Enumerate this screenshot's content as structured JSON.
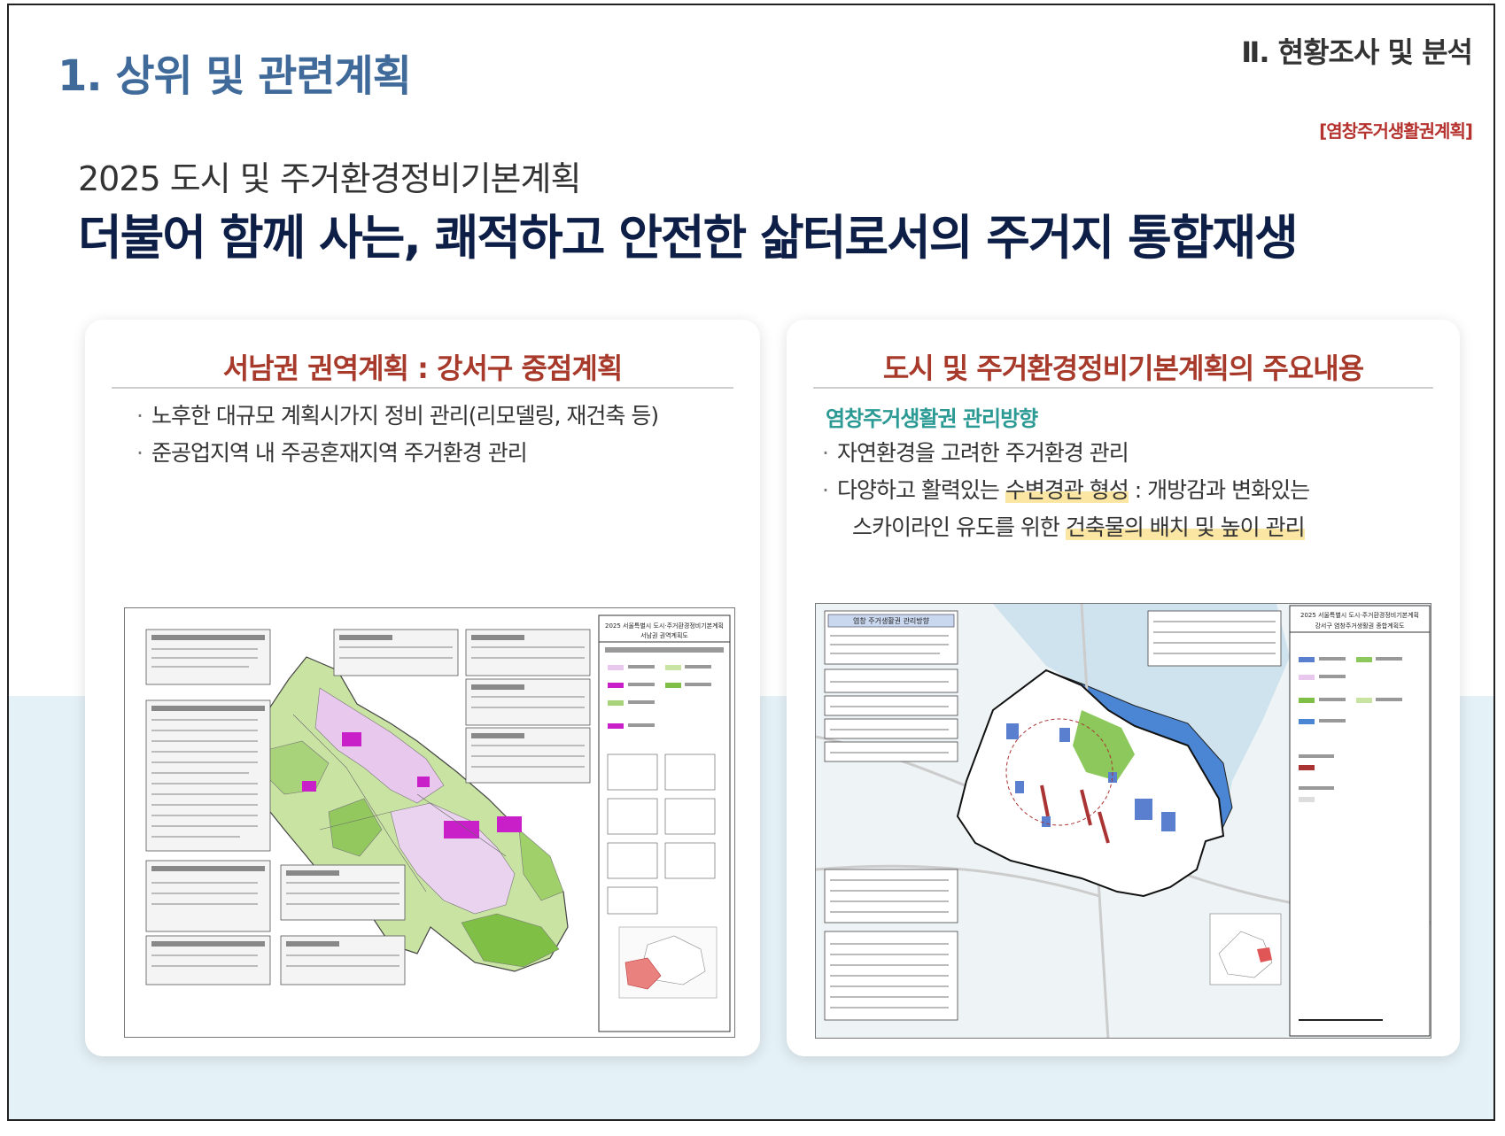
{
  "header": {
    "section_title": "1. 상위 및 관련계획",
    "chapter": "Ⅱ. 현황조사 및 분석",
    "tag": "[염창주거생활권계획]",
    "subtitle": "2025 도시 및 주거환경정비기본계획",
    "headline": "더불어 함께 사는, 쾌적하고 안전한 삶터로서의 주거지 통합재생"
  },
  "left_card": {
    "title": "서남권 권역계획 : 강서구 중점계획",
    "bullets": [
      "노후한 대규모 계획시가지 정비 관리(리모델링, 재건축 등)",
      "준공업지역 내 주공혼재지역 주거환경 관리"
    ],
    "map": {
      "legend_title": "2025 서울특별시 도시·주거환경정비기본계획",
      "legend_subtitle": "서남권 권역계획도"
    }
  },
  "right_card": {
    "title": "도시 및 주거환경정비기본계획의 주요내용",
    "subhead": "염창주거생활권 관리방향",
    "bullets": [
      {
        "parts": [
          "자연환경을 고려한 주거환경 관리"
        ]
      },
      {
        "parts": [
          "다양하고 활력있는 ",
          "수변경관 형성",
          " : 개방감과 변화있는"
        ]
      },
      {
        "parts": [
          "스카이라인 유도를 위한 ",
          "건축물의 배치 및 높이 관리"
        ]
      }
    ],
    "map": {
      "panel_title": "염창 주거생활권 관리방향",
      "legend_title": "2025 서울특별시 도시·주거환경정비기본계획",
      "legend_subtitle": "강서구 염창주거생활권 종합계획도"
    }
  },
  "colors": {
    "section_title": "#3f6a9a",
    "headline": "#0e1f47",
    "card_title": "#a83a2c",
    "subhead": "#2b9a94",
    "highlight": "#fbe7a3",
    "bottom_band": "#e4f1f6"
  }
}
